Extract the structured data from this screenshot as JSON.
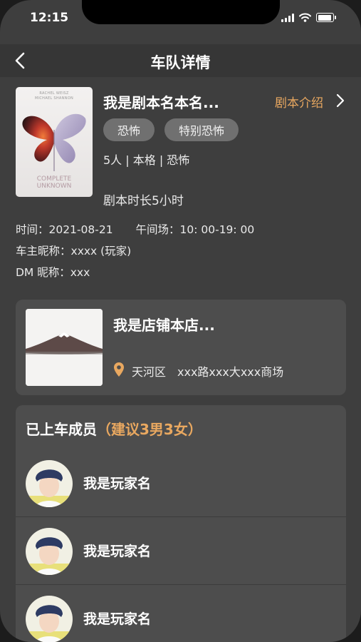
{
  "status_bar": {
    "time": "12:15"
  },
  "navbar": {
    "title": "车队详情"
  },
  "script": {
    "name": "我是剧本名本名...",
    "intro_link": "剧本介绍",
    "tags": [
      "恐怖",
      "特别恐怖"
    ],
    "meta": "5人 | 本格 | 恐怖",
    "duration": "剧本时长5小时",
    "cover": {
      "top_text_1": "RACHEL WEISZ",
      "top_text_2": "MICHAEL SHANNON",
      "title_1": "COMPLETE",
      "title_2": "UNKNOWN"
    }
  },
  "details": {
    "time_label": "时间：",
    "time_value": "2021-08-21",
    "session_label": "午间场：",
    "session_value": "10: 00-19: 00",
    "host_label": "车主昵称：",
    "host_value": "xxxx (玩家)",
    "dm_label": "DM 昵称：",
    "dm_value": "xxx"
  },
  "shop": {
    "name": "我是店铺本店...",
    "district": "天河区",
    "address": "xxx路xxx大xxx商场"
  },
  "members": {
    "title": "已上车成员",
    "hint": "（建议3男3女）",
    "list": [
      {
        "name": "我是玩家名"
      },
      {
        "name": "我是玩家名"
      },
      {
        "name": "我是玩家名"
      }
    ]
  },
  "colors": {
    "accent": "#e9a860",
    "background": "#3e3e3e",
    "card": "#4d4d4d",
    "tag": "#707070"
  }
}
